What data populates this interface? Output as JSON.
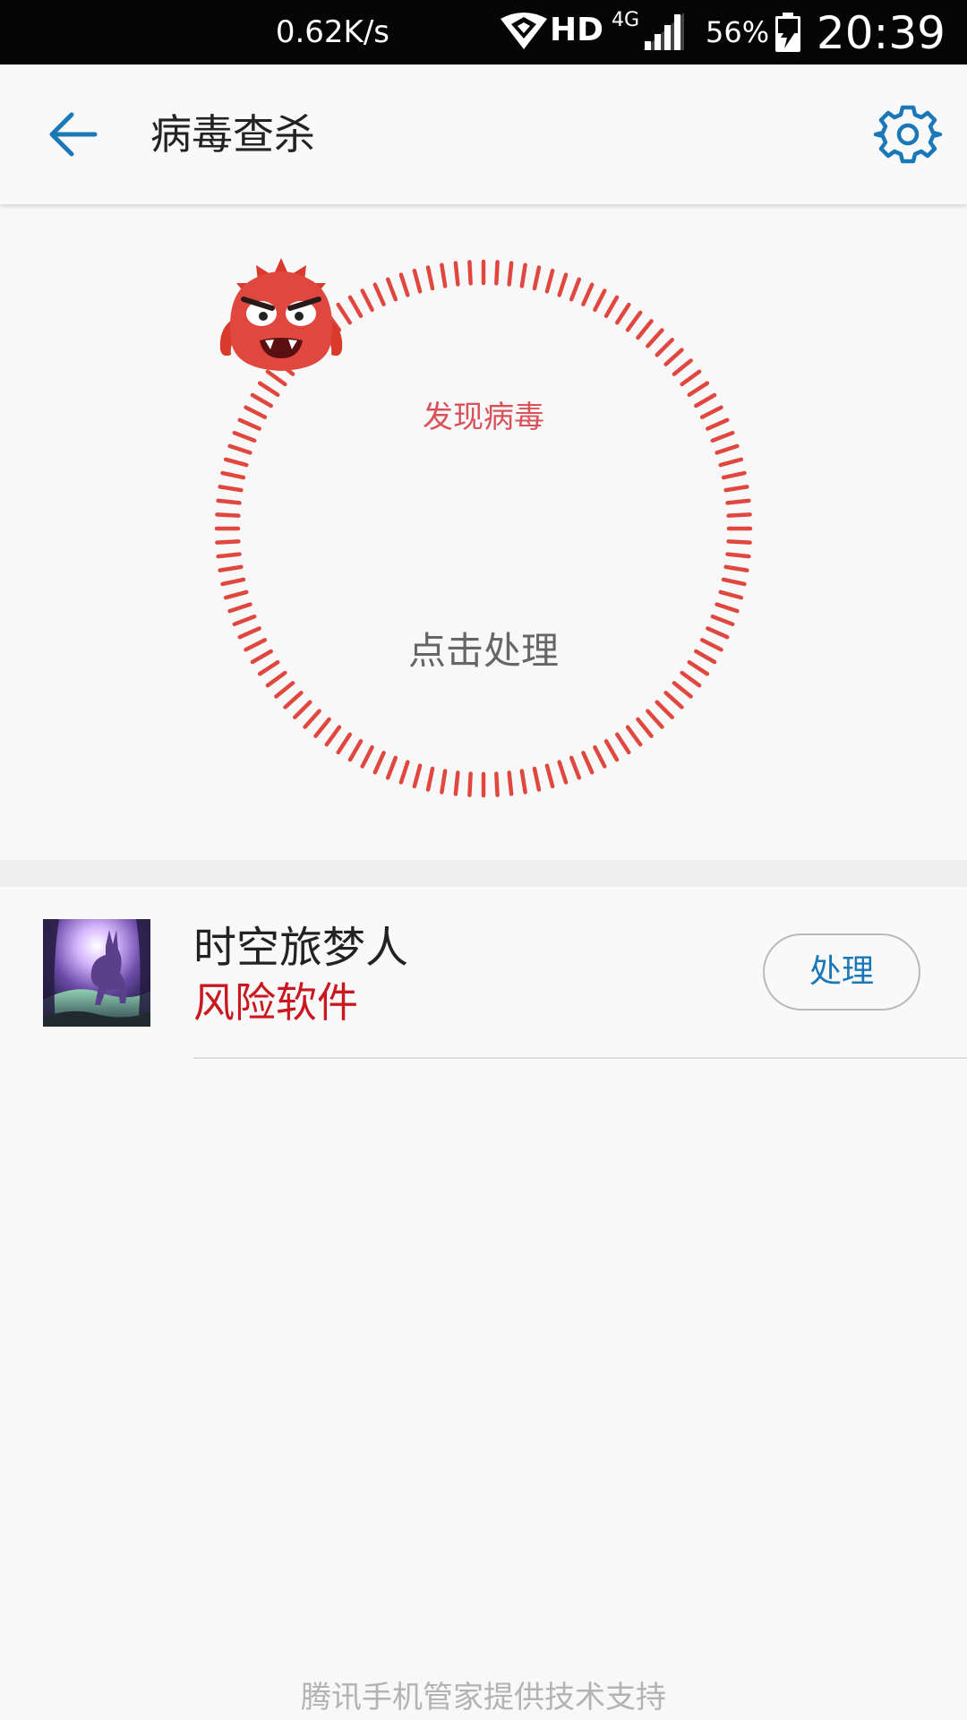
{
  "status_bar": {
    "speed": "0.62K/s",
    "hd": "HD",
    "network": "4G",
    "battery": "56%",
    "time": "20:39"
  },
  "app_bar": {
    "title": "病毒查杀",
    "back_icon": "back-arrow-icon",
    "settings_icon": "gear-icon"
  },
  "scan": {
    "status": "发现病毒",
    "action": "点击处理",
    "icon": "virus-mascot-icon",
    "accent_color": "#e0473f"
  },
  "results": [
    {
      "app_name": "时空旅梦人",
      "risk": "风险软件",
      "button": "处理"
    }
  ],
  "footer": "腾讯手机管家提供技术支持",
  "colors": {
    "accent_blue": "#1a78b8",
    "danger_red": "#c9181f"
  }
}
